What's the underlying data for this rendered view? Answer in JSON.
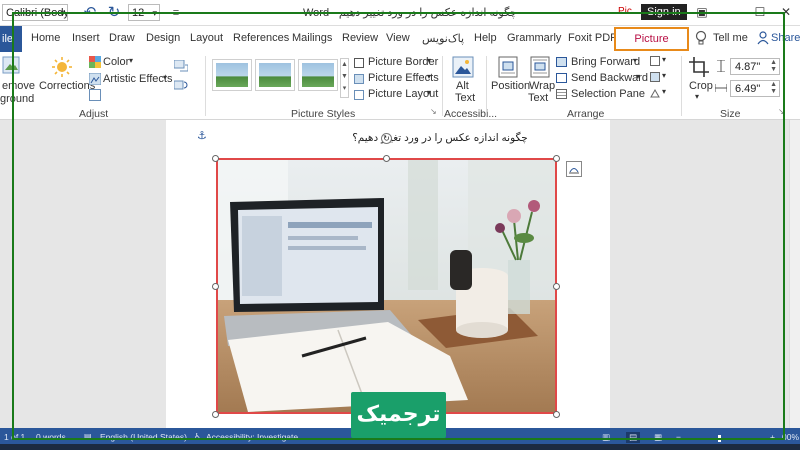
{
  "titlebar": {
    "font_name": "Calibri (Body)",
    "font_size": "12",
    "doc_title": "چگونه اندازه عکس را در ورد تغییر دهیم - Word",
    "picture_tools_label": "Pic",
    "sign_in": "Sign in"
  },
  "tabs": {
    "file": "ile",
    "items": [
      "Home",
      "Insert",
      "Draw",
      "Design",
      "Layout",
      "References",
      "Mailings",
      "Review",
      "View",
      "پاک‌نویس",
      "Help",
      "Grammarly",
      "Foxit PDF"
    ],
    "active": "Picture Format",
    "tell_me": "Tell me",
    "share": "Share"
  },
  "ribbon": {
    "remove_bg_line1": "emove",
    "remove_bg_line2": "ground",
    "corrections": "Corrections",
    "color": "Color",
    "artistic_effects": "Artistic Effects",
    "adjust_label": "Adjust",
    "picture_border": "Picture Border",
    "picture_effects": "Picture Effects",
    "picture_layout": "Picture Layout",
    "picture_styles_label": "Picture Styles",
    "alt_text_line1": "Alt",
    "alt_text_line2": "Text",
    "accessibility_label": "Accessibi...",
    "position": "Position",
    "wrap_text_line1": "Wrap",
    "wrap_text_line2": "Text",
    "bring_forward": "Bring Forward",
    "send_backward": "Send Backward",
    "selection_pane": "Selection Pane",
    "arrange_label": "Arrange",
    "crop": "Crop",
    "height_value": "4.87\"",
    "width_value": "6.49\"",
    "size_label": "Size"
  },
  "document": {
    "heading": "چگونه اندازه عکس را در ورد تغییر دهیم؟"
  },
  "statusbar": {
    "page": "1 of 1",
    "words": "0 words",
    "language": "English (United States)",
    "accessibility": "Accessibility: Investigate",
    "zoom": "00%"
  },
  "watermark": {
    "text": "ترجمیک"
  },
  "colors": {
    "word_blue": "#2b579a",
    "picture_format_accent": "#b80f44",
    "tab_highlight_border": "#e88a1a",
    "frame_green": "#1a7a1a",
    "watermark_green": "#1a9f6a",
    "selection_red": "#e04848"
  }
}
